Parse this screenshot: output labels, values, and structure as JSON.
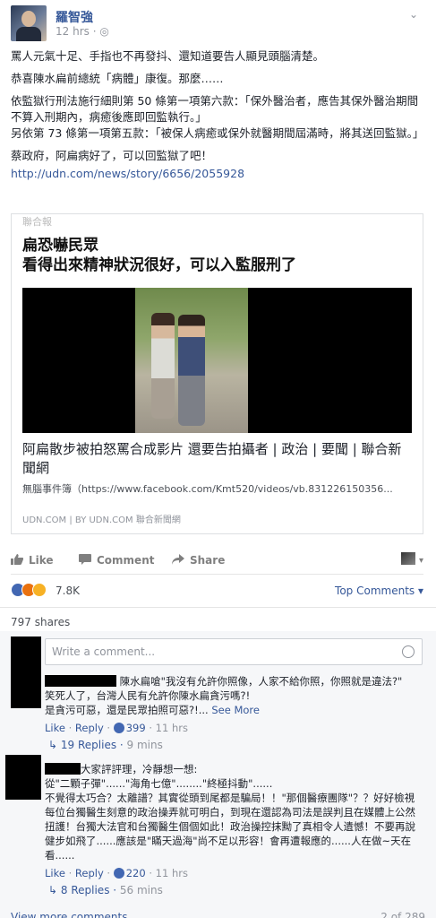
{
  "post": {
    "author": "羅智強",
    "time": "12 hrs",
    "paragraphs": [
      "罵人元氣十足、手指也不再發抖、還知道要告人顯見頭腦清楚。",
      "恭喜陳水扁前總統「病體」康復。那麼……",
      "依監獄行刑法施行細則第 50 條第一項第六款：「保外醫治者，應告其保外醫治期間不算入刑期內，病癒後應即回監執行。」",
      "另依第 73 條第一項第五款：「被保人病癒或保外就醫期間屆滿時，將其送回監獄。」",
      "蔡政府，阿扁病好了，可以回監獄了吧！"
    ],
    "url": "http://udn.com/news/story/6656/2055928"
  },
  "shared": {
    "top_strip": "聯合報",
    "headline_1": "扁恐嚇民眾",
    "headline_2": "看得出來精神狀況很好，可以入監服刑了",
    "title": "阿扁散步被拍怒罵合成影片 還要告拍攝者 | 政治 | 要聞 | 聯合新聞網",
    "desc": "無腦事件簿（https://www.facebook.com/Kmt520/videos/vb.831226150356...",
    "source": "UDN.COM | BY UDN.COM 聯合新聞網"
  },
  "actions": {
    "like": "Like",
    "comment": "Comment",
    "share": "Share"
  },
  "reactions": {
    "count": "7.8K",
    "top_comments": "Top Comments",
    "shares": "797 shares"
  },
  "comment_box": {
    "placeholder": "Write a comment..."
  },
  "comments": [
    {
      "line1": "陳水扁嗆\"我沒有允許你照像，人家不給你照，你照就是違法?\"",
      "line2": "笑死人了，台灣人民有允許你陳水扁貪污嗎?!",
      "line3": "是貪污可惡，還是民眾拍照可惡?!...",
      "see_more": "See More",
      "like": "Like",
      "reply": "Reply",
      "likes": "399",
      "time": "11 hrs",
      "replies": "19 Replies",
      "replies_time": "9 mins"
    },
    {
      "line1": "大家評評理，冷靜想一想:",
      "line2": "從\"二顆子彈\"......\"海角七億\"........\"終極抖動\"......",
      "line3": "不覺得太巧合？太離譜？其實從頭到尾都是騙局！！\"那個醫療團隊\"？？好好檢視每位台獨醫生刻意的政治操弄就可明白，到現在還認為司法是誤判且在媒體上公然扭護！台獨大法官和台獨醫生個個如此！政治操控抹黝了真相令人遺憾！不要再說健步如飛了......應該是\"瞞天過海\"尚不足以形容！會再遭報應的......人在做~天在看......",
      "like": "Like",
      "reply": "Reply",
      "likes": "220",
      "time": "11 hrs",
      "replies": "8 Replies",
      "replies_time": "56 mins"
    }
  ],
  "footer": {
    "view_more": "View more comments",
    "count": "2 of 289"
  },
  "colors": {
    "link": "#365899",
    "meta": "#90949c",
    "like_blue": "#4267b2"
  },
  "icons": [
    "chevron-down-icon",
    "like-icon",
    "comment-icon",
    "share-icon",
    "like-reaction-icon",
    "angry-reaction-icon",
    "haha-reaction-icon",
    "emoji-icon"
  ]
}
